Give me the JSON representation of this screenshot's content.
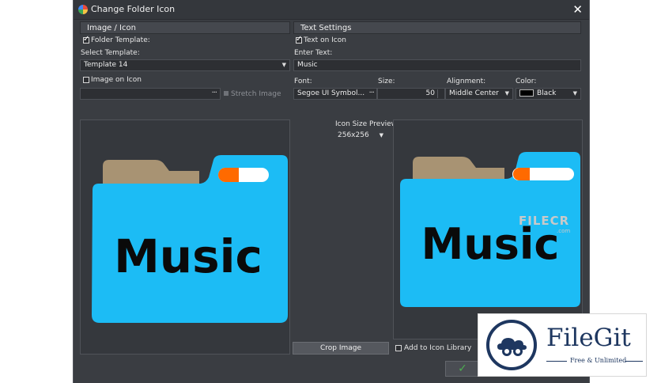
{
  "window": {
    "title": "Change Folder Icon",
    "close_glyph": "✕"
  },
  "image_icon": {
    "header": "Image / Icon",
    "folder_template_label": "Folder Template:",
    "select_template_label": "Select Template:",
    "template_value": "Template 14",
    "image_on_icon_label": "Image on Icon",
    "browse_glyph": "···",
    "stretch_image_label": "Stretch Image"
  },
  "text_settings": {
    "header": "Text Settings",
    "text_on_icon_label": "Text on Icon",
    "enter_text_label": "Enter Text:",
    "text_value": "Music",
    "font_label": "Font:",
    "font_value": "Segoe UI Symbol...",
    "size_label": "Size:",
    "size_value": "50",
    "alignment_label": "Alignment:",
    "alignment_value": "Middle Center",
    "color_label": "Color:",
    "color_value": "Black"
  },
  "preview": {
    "icon_size_label": "Icon Size Preview:",
    "icon_size_value": "256x256",
    "folder_text": "Music",
    "crop_image_label": "Crop Image",
    "add_to_library_label": "Add to Icon Library"
  },
  "colors": {
    "folder_front": "#1cbcf5",
    "folder_back": "#a89373",
    "folder_tab_orange": "#ff6a00",
    "folder_tab_white": "#ffffff",
    "window_bg": "#3a3d42"
  },
  "watermarks": {
    "filecr": "FILECR",
    "filecr_suffix": ".com",
    "filegit_name": "FileGit",
    "filegit_tagline": "Free & Unlimited"
  },
  "icons": [
    "app-icon",
    "close-icon",
    "checkbox-icon",
    "chevron-down-icon",
    "ellipsis-icon",
    "checkmark-icon",
    "filegit-cloud-logo"
  ]
}
